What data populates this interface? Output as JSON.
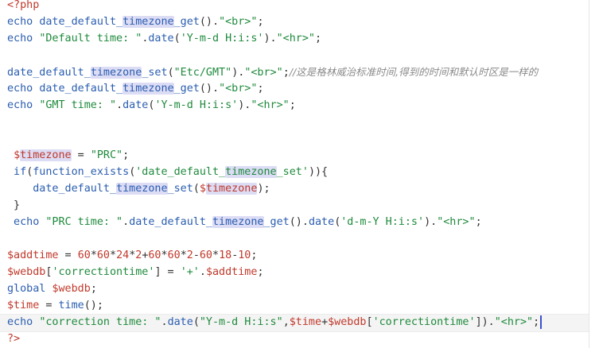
{
  "lines": [
    {
      "parts": [
        {
          "t": "<?php",
          "c": "tag"
        }
      ]
    },
    {
      "parts": [
        {
          "t": "echo ",
          "c": "kw"
        },
        {
          "t": "date_default_",
          "c": "fn"
        },
        {
          "t": "timezone",
          "c": "fn hl"
        },
        {
          "t": "_get",
          "c": "fn"
        },
        {
          "t": "().",
          "c": "op"
        },
        {
          "t": "\"<br>\"",
          "c": "str"
        },
        {
          "t": ";",
          "c": "op"
        }
      ]
    },
    {
      "parts": [
        {
          "t": "echo ",
          "c": "kw"
        },
        {
          "t": "\"Default time: \"",
          "c": "str"
        },
        {
          "t": ".",
          "c": "op"
        },
        {
          "t": "date",
          "c": "fn"
        },
        {
          "t": "(",
          "c": "op"
        },
        {
          "t": "'Y-m-d H:i:s'",
          "c": "str"
        },
        {
          "t": ").",
          "c": "op"
        },
        {
          "t": "\"<hr>\"",
          "c": "str"
        },
        {
          "t": ";",
          "c": "op"
        }
      ]
    },
    {
      "parts": []
    },
    {
      "parts": [
        {
          "t": "date_default_",
          "c": "fn"
        },
        {
          "t": "timezone",
          "c": "fn hl"
        },
        {
          "t": "_set",
          "c": "fn"
        },
        {
          "t": "(",
          "c": "op"
        },
        {
          "t": "\"Etc/GMT\"",
          "c": "str"
        },
        {
          "t": ").",
          "c": "op"
        },
        {
          "t": "\"<br>\"",
          "c": "str"
        },
        {
          "t": ";",
          "c": "op"
        },
        {
          "t": "//这是格林威治标准时间,得到的时间和默认时区是一样的",
          "c": "cm"
        }
      ]
    },
    {
      "parts": [
        {
          "t": "echo ",
          "c": "kw"
        },
        {
          "t": "date_default_",
          "c": "fn"
        },
        {
          "t": "timezone",
          "c": "fn hl"
        },
        {
          "t": "_get",
          "c": "fn"
        },
        {
          "t": "().",
          "c": "op"
        },
        {
          "t": "\"<br>\"",
          "c": "str"
        },
        {
          "t": ";",
          "c": "op"
        }
      ]
    },
    {
      "parts": [
        {
          "t": "echo ",
          "c": "kw"
        },
        {
          "t": "\"GMT time: \"",
          "c": "str"
        },
        {
          "t": ".",
          "c": "op"
        },
        {
          "t": "date",
          "c": "fn"
        },
        {
          "t": "(",
          "c": "op"
        },
        {
          "t": "'Y-m-d H:i:s'",
          "c": "str"
        },
        {
          "t": ").",
          "c": "op"
        },
        {
          "t": "\"<hr>\"",
          "c": "str"
        },
        {
          "t": ";",
          "c": "op"
        }
      ]
    },
    {
      "parts": []
    },
    {
      "parts": []
    },
    {
      "parts": [
        {
          "t": " ",
          "c": "op"
        },
        {
          "t": "$",
          "c": "var"
        },
        {
          "t": "timezone",
          "c": "var hl"
        },
        {
          "t": " = ",
          "c": "op"
        },
        {
          "t": "\"PRC\"",
          "c": "str"
        },
        {
          "t": ";",
          "c": "op"
        }
      ]
    },
    {
      "parts": [
        {
          "t": " if",
          "c": "kw"
        },
        {
          "t": "(",
          "c": "op"
        },
        {
          "t": "function_exists",
          "c": "fn"
        },
        {
          "t": "(",
          "c": "op"
        },
        {
          "t": "'date_default_",
          "c": "str"
        },
        {
          "t": "timezone",
          "c": "str hl"
        },
        {
          "t": "_set'",
          "c": "str"
        },
        {
          "t": ")){",
          "c": "op"
        }
      ]
    },
    {
      "parts": [
        {
          "t": "    date_default_",
          "c": "fn"
        },
        {
          "t": "timezone",
          "c": "fn hl"
        },
        {
          "t": "_set",
          "c": "fn"
        },
        {
          "t": "(",
          "c": "op"
        },
        {
          "t": "$",
          "c": "var"
        },
        {
          "t": "timezone",
          "c": "var hl"
        },
        {
          "t": ");",
          "c": "op"
        }
      ]
    },
    {
      "parts": [
        {
          "t": " }",
          "c": "op"
        }
      ]
    },
    {
      "parts": [
        {
          "t": " echo ",
          "c": "kw"
        },
        {
          "t": "\"PRC time: \"",
          "c": "str"
        },
        {
          "t": ".",
          "c": "op"
        },
        {
          "t": "date_default_",
          "c": "fn"
        },
        {
          "t": "timezone",
          "c": "fn hl"
        },
        {
          "t": "_get",
          "c": "fn"
        },
        {
          "t": "().",
          "c": "op"
        },
        {
          "t": "date",
          "c": "fn"
        },
        {
          "t": "(",
          "c": "op"
        },
        {
          "t": "'d-m-Y H:i:s'",
          "c": "str"
        },
        {
          "t": ").",
          "c": "op"
        },
        {
          "t": "\"<hr>\"",
          "c": "str"
        },
        {
          "t": ";",
          "c": "op"
        }
      ]
    },
    {
      "parts": []
    },
    {
      "parts": [
        {
          "t": "$addtime",
          "c": "var"
        },
        {
          "t": " = ",
          "c": "op"
        },
        {
          "t": "60",
          "c": "num"
        },
        {
          "t": "*",
          "c": "op"
        },
        {
          "t": "60",
          "c": "num"
        },
        {
          "t": "*",
          "c": "op"
        },
        {
          "t": "24",
          "c": "num"
        },
        {
          "t": "*",
          "c": "op"
        },
        {
          "t": "2",
          "c": "num"
        },
        {
          "t": "+",
          "c": "op"
        },
        {
          "t": "60",
          "c": "num"
        },
        {
          "t": "*",
          "c": "op"
        },
        {
          "t": "60",
          "c": "num"
        },
        {
          "t": "*",
          "c": "op"
        },
        {
          "t": "2",
          "c": "num"
        },
        {
          "t": "-",
          "c": "op"
        },
        {
          "t": "60",
          "c": "num"
        },
        {
          "t": "*",
          "c": "op"
        },
        {
          "t": "18",
          "c": "num"
        },
        {
          "t": "-",
          "c": "op"
        },
        {
          "t": "10",
          "c": "num"
        },
        {
          "t": ";",
          "c": "op"
        }
      ]
    },
    {
      "parts": [
        {
          "t": "$webdb",
          "c": "var"
        },
        {
          "t": "[",
          "c": "op"
        },
        {
          "t": "'correctiontime'",
          "c": "str"
        },
        {
          "t": "] = ",
          "c": "op"
        },
        {
          "t": "'+'",
          "c": "str"
        },
        {
          "t": ".",
          "c": "op"
        },
        {
          "t": "$addtime",
          "c": "var"
        },
        {
          "t": ";",
          "c": "op"
        }
      ]
    },
    {
      "parts": [
        {
          "t": "global ",
          "c": "kw"
        },
        {
          "t": "$webdb",
          "c": "var"
        },
        {
          "t": ";",
          "c": "op"
        }
      ]
    },
    {
      "parts": [
        {
          "t": "$time",
          "c": "var"
        },
        {
          "t": " = ",
          "c": "op"
        },
        {
          "t": "time",
          "c": "fn"
        },
        {
          "t": "();",
          "c": "op"
        }
      ]
    },
    {
      "parts": [
        {
          "t": "echo ",
          "c": "kw"
        },
        {
          "t": "\"correction time: \"",
          "c": "str"
        },
        {
          "t": ".",
          "c": "op"
        },
        {
          "t": "date",
          "c": "fn"
        },
        {
          "t": "(",
          "c": "op"
        },
        {
          "t": "\"Y-m-d H:i:s\"",
          "c": "str"
        },
        {
          "t": ",",
          "c": "op"
        },
        {
          "t": "$time",
          "c": "var"
        },
        {
          "t": "+",
          "c": "op"
        },
        {
          "t": "$webdb",
          "c": "var"
        },
        {
          "t": "[",
          "c": "op"
        },
        {
          "t": "'correctiontime'",
          "c": "str"
        },
        {
          "t": "]).",
          "c": "op"
        },
        {
          "t": "\"<hr>\"",
          "c": "str"
        },
        {
          "t": ";",
          "c": "op"
        }
      ],
      "caret": true
    },
    {
      "parts": [
        {
          "t": "?>",
          "c": "tag"
        }
      ]
    }
  ]
}
